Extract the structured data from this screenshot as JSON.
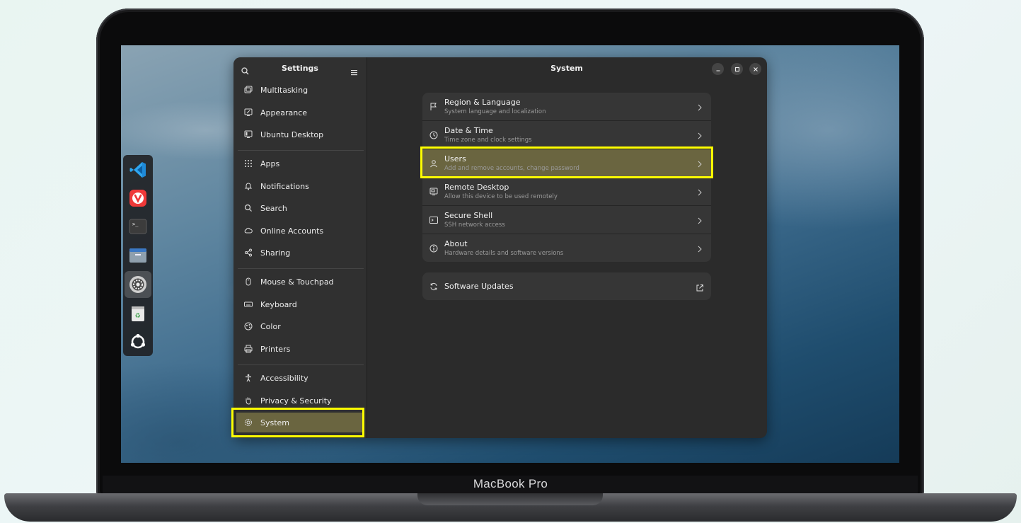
{
  "device": {
    "brand_label": "MacBook Pro"
  },
  "dock": {
    "items": [
      {
        "name": "vscode-icon",
        "active": false
      },
      {
        "name": "vivaldi-icon",
        "active": false
      },
      {
        "name": "terminal-icon",
        "active": false
      },
      {
        "name": "files-icon",
        "active": false
      },
      {
        "name": "settings-icon",
        "active": true
      },
      {
        "name": "trash-icon",
        "active": false
      },
      {
        "name": "ubuntu-icon",
        "active": false
      }
    ]
  },
  "sidebar": {
    "title": "Settings",
    "items": [
      {
        "label": "Multitasking",
        "icon": "multitasking-icon"
      },
      {
        "label": "Appearance",
        "icon": "appearance-icon"
      },
      {
        "label": "Ubuntu Desktop",
        "icon": "ubuntu-desktop-icon"
      },
      {
        "label": "Apps",
        "icon": "apps-icon"
      },
      {
        "label": "Notifications",
        "icon": "bell-icon"
      },
      {
        "label": "Search",
        "icon": "search-icon"
      },
      {
        "label": "Online Accounts",
        "icon": "cloud-icon"
      },
      {
        "label": "Sharing",
        "icon": "share-icon"
      },
      {
        "label": "Mouse & Touchpad",
        "icon": "mouse-icon"
      },
      {
        "label": "Keyboard",
        "icon": "keyboard-icon"
      },
      {
        "label": "Color",
        "icon": "color-icon"
      },
      {
        "label": "Printers",
        "icon": "printer-icon"
      },
      {
        "label": "Accessibility",
        "icon": "accessibility-icon"
      },
      {
        "label": "Privacy & Security",
        "icon": "hand-icon"
      },
      {
        "label": "System",
        "icon": "gear-icon",
        "selected": true
      }
    ]
  },
  "main": {
    "title": "System",
    "rows": [
      {
        "title": "Region & Language",
        "subtitle": "System language and localization",
        "icon": "flag-icon"
      },
      {
        "title": "Date & Time",
        "subtitle": "Time zone and clock settings",
        "icon": "clock-icon"
      },
      {
        "title": "Users",
        "subtitle": "Add and remove accounts, change password",
        "icon": "users-icon",
        "highlighted": true
      },
      {
        "title": "Remote Desktop",
        "subtitle": "Allow this device to be used remotely",
        "icon": "remote-desktop-icon"
      },
      {
        "title": "Secure Shell",
        "subtitle": "SSH network access",
        "icon": "terminal-icon"
      },
      {
        "title": "About",
        "subtitle": "Hardware details and software versions",
        "icon": "info-icon"
      }
    ],
    "updates": {
      "title": "Software Updates",
      "icon": "refresh-icon"
    }
  },
  "colors": {
    "highlight": "#ffff00",
    "selection": "#6a6540"
  }
}
